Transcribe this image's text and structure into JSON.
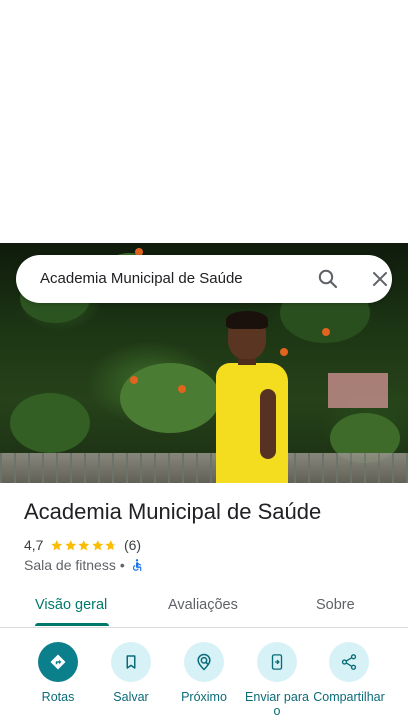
{
  "search": {
    "query": "Academia Municipal de Saúde"
  },
  "place": {
    "title": "Academia Municipal de Saúde",
    "rating": "4,7",
    "rating_value": 4.7,
    "stars_max": 5,
    "review_count": "(6)",
    "category": "Sala de fitness",
    "separator": "•",
    "accessibility_icon": "wheelchair-icon"
  },
  "tabs": [
    {
      "label": "Visão geral",
      "active": true
    },
    {
      "label": "Avaliações",
      "active": false
    },
    {
      "label": "Sobre",
      "active": false
    }
  ],
  "actions": [
    {
      "label": "Rotas",
      "icon": "directions-icon"
    },
    {
      "label": "Salvar",
      "icon": "bookmark-icon"
    },
    {
      "label": "Próximo",
      "icon": "nearby-icon"
    },
    {
      "label": "Enviar para o",
      "icon": "send-to-phone-icon"
    },
    {
      "label": "Compartilhar",
      "icon": "share-icon"
    }
  ],
  "colors": {
    "accent": "#00796b",
    "action_primary": "#0b7f8c",
    "action_bg": "#d7f2f7",
    "star": "#fbbc04",
    "accessibility": "#1a73e8"
  }
}
